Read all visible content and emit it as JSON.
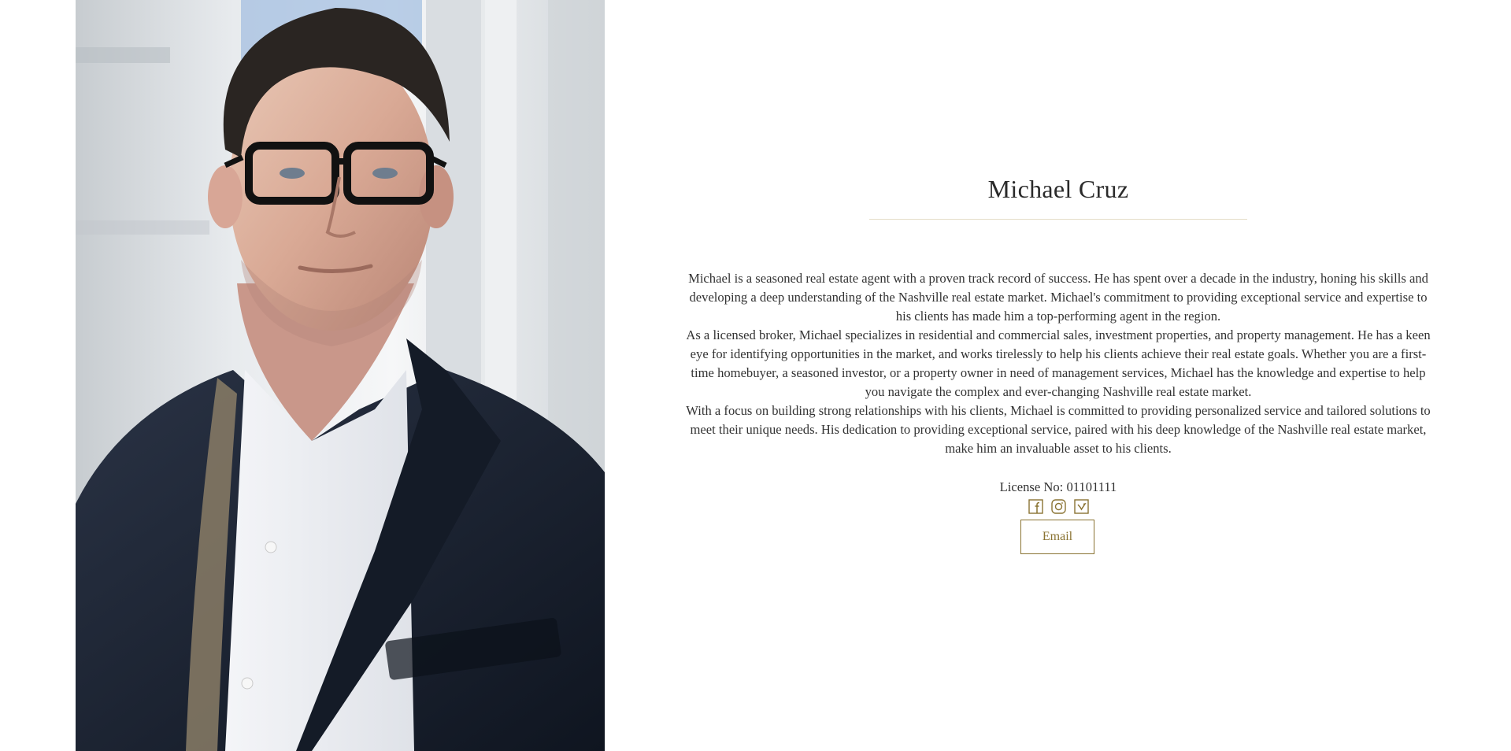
{
  "agent": {
    "name": "Michael Cruz",
    "bio": [
      "Michael is a seasoned real estate agent with a proven track record of success. He has spent over a decade in the industry, honing his skills and developing a deep understanding of the Nashville real estate market. Michael's commitment to providing exceptional service and expertise to his clients has made him a top-performing agent in the region.",
      "As a licensed broker, Michael specializes in residential and commercial sales, investment properties, and property management. He has a keen eye for identifying opportunities in the market, and works tirelessly to help his clients achieve their real estate goals. Whether you are a first-time homebuyer, a seasoned investor, or a property owner in need of management services, Michael has the knowledge and expertise to help you navigate the complex and ever-changing Nashville real estate market.",
      "With a focus on building strong relationships with his clients, Michael is committed to providing personalized service and tailored solutions to meet their unique needs. His dedication to providing exceptional service, paired with his deep knowledge of the Nashville real estate market, make him an invaluable asset to his clients."
    ],
    "license_label": "License No:",
    "license_number": "01101111"
  },
  "socials": [
    {
      "icon": "facebook-icon"
    },
    {
      "icon": "instagram-icon"
    },
    {
      "icon": "twitter-icon"
    }
  ],
  "email_button": {
    "label": "Email"
  },
  "colors": {
    "accent": "#8a7332",
    "divider": "#e4dcc6",
    "text": "#333333"
  }
}
